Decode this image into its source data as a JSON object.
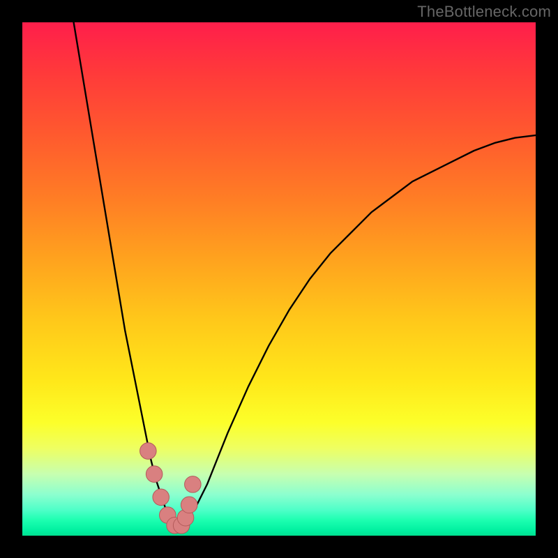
{
  "watermark": "TheBottleneck.com",
  "colors": {
    "frame": "#000000",
    "curve": "#000000",
    "marker_fill": "#d98080",
    "marker_stroke": "#b35a5a"
  },
  "chart_data": {
    "type": "line",
    "title": "",
    "xlabel": "",
    "ylabel": "",
    "xlim": [
      0,
      100
    ],
    "ylim": [
      0,
      100
    ],
    "grid": false,
    "note": "x is a normalized component-balance parameter (0–100); y is bottleneck percentage (0 at bottom = perfect match, 100 at top = full bottleneck). No axis ticks or numeric labels are rendered in the image; values are read purely from curve position against the frame.",
    "series": [
      {
        "name": "bottleneck-curve",
        "x": [
          10,
          12,
          14,
          16,
          18,
          20,
          22,
          24,
          25,
          26,
          27,
          28,
          29,
          30,
          31,
          32,
          34,
          36,
          38,
          40,
          44,
          48,
          52,
          56,
          60,
          64,
          68,
          72,
          76,
          80,
          84,
          88,
          92,
          96,
          100
        ],
        "y": [
          100,
          88,
          76,
          64,
          52,
          40,
          30,
          20,
          15,
          11,
          8,
          5,
          3,
          2,
          2,
          3,
          6,
          10,
          15,
          20,
          29,
          37,
          44,
          50,
          55,
          59,
          63,
          66,
          69,
          71,
          73,
          75,
          76.5,
          77.5,
          78
        ]
      }
    ],
    "markers": {
      "name": "highlighted-range",
      "x": [
        24.5,
        25.7,
        27.0,
        28.3,
        29.7,
        31.0,
        31.8,
        32.5,
        33.2
      ],
      "y": [
        16.5,
        12.0,
        7.5,
        4.0,
        2.0,
        2.0,
        3.5,
        6.0,
        10.0
      ],
      "r": 1.6
    }
  }
}
